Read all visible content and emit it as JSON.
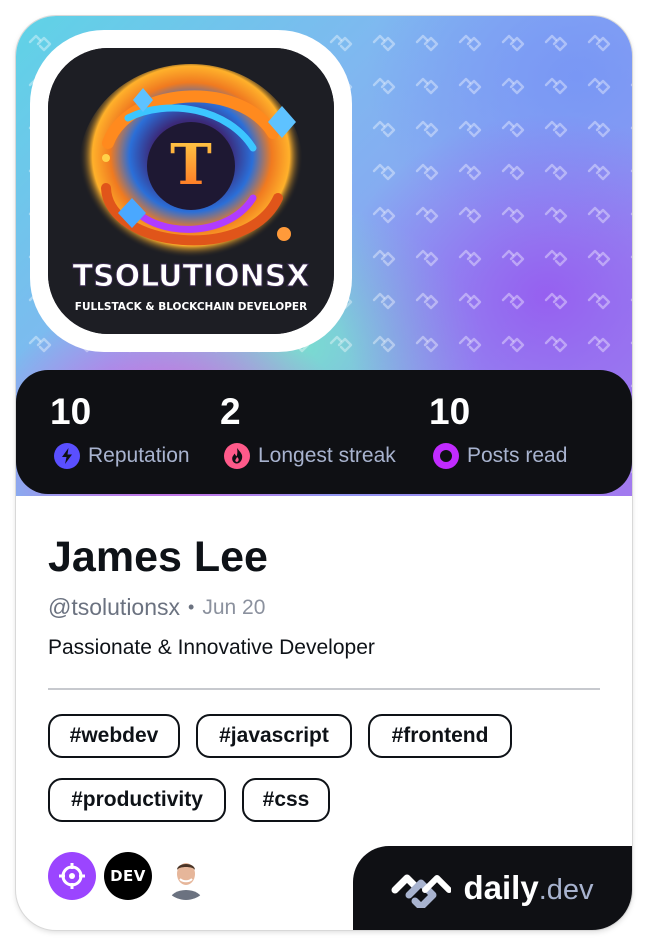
{
  "avatar": {
    "logo_text": "TSOLUTIONSX",
    "logo_subtitle": "FULLSTACK & BLOCKCHAIN DEVELOPER",
    "emblem_letter": "T"
  },
  "stats": [
    {
      "value": "10",
      "label": "Reputation",
      "icon": "lightning-icon",
      "color": "#5a4fff"
    },
    {
      "value": "2",
      "label": "Longest streak",
      "icon": "flame-icon",
      "color": "#ff5a8a"
    },
    {
      "value": "10",
      "label": "Posts read",
      "icon": "ring-icon",
      "color": "#c12bff"
    }
  ],
  "profile": {
    "name": "James Lee",
    "handle": "@tsolutionsx",
    "separator": "•",
    "joined": "Jun 20",
    "bio": "Passionate & Innovative Developer"
  },
  "tags": [
    "#webdev",
    "#javascript",
    "#frontend",
    "#productivity",
    "#css"
  ],
  "badges": [
    {
      "icon": "crosshair-icon",
      "color": "#9b45ff"
    },
    {
      "icon": "dev-logo-icon",
      "text": "DEV",
      "color": "#000000"
    },
    {
      "icon": "user-photo-icon"
    }
  ],
  "brand": {
    "name": "daily",
    "tld": ".dev"
  }
}
